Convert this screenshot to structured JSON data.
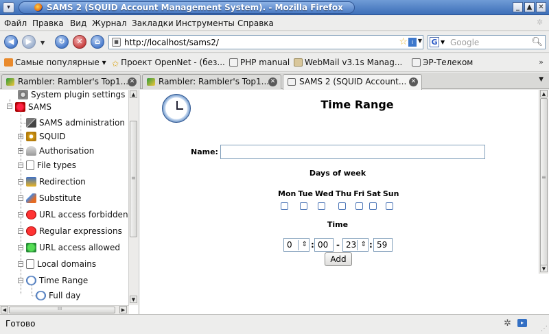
{
  "window": {
    "title": "SAMS 2 (SQUID Account Management System). - Mozilla Firefox",
    "controls": {
      "menu": "▾",
      "minimize": "_",
      "maximize": "▲",
      "close": "✕"
    }
  },
  "menubar": {
    "items": [
      "Файл",
      "Правка",
      "Вид",
      "Журнал",
      "Закладки",
      "Инструменты",
      "Справка"
    ]
  },
  "navbar": {
    "url": "http://localhost/sams2/",
    "search_placeholder": "Google",
    "search_engine": "G",
    "back": "◀",
    "forward": "▶",
    "reload": "↻",
    "stop": "✕",
    "home": "⌂"
  },
  "bookmarks": {
    "items": [
      "Самые популярные ▾",
      "Проект OpenNet - (без...",
      "PHP manual",
      "WebMail v3.1s Manag...",
      "ЭР-Телеком"
    ],
    "more": "»"
  },
  "tabs": {
    "items": [
      {
        "label": "Rambler: Rambler's Top1...",
        "active": false
      },
      {
        "label": "Rambler: Rambler's Top1...",
        "active": false
      },
      {
        "label": "SAMS 2 (SQUID Account...",
        "active": true
      }
    ]
  },
  "sidebar": {
    "items": [
      {
        "label": "System plugin settings",
        "expander": ""
      },
      {
        "label": "SAMS",
        "expander": "−"
      },
      {
        "label": "SAMS administration",
        "expander": ""
      },
      {
        "label": "SQUID",
        "expander": "+"
      },
      {
        "label": "Authorisation",
        "expander": "+"
      },
      {
        "label": "File types",
        "expander": "−"
      },
      {
        "label": "Redirection",
        "expander": "−"
      },
      {
        "label": "Substitute",
        "expander": "−"
      },
      {
        "label": "URL access forbidden",
        "expander": "−"
      },
      {
        "label": "Regular expressions",
        "expander": "−"
      },
      {
        "label": "URL access allowed",
        "expander": "−"
      },
      {
        "label": "Local domains",
        "expander": "−"
      },
      {
        "label": "Time Range",
        "expander": "−"
      },
      {
        "label": "Full day",
        "expander": ""
      }
    ],
    "scroll_mid": "≡",
    "hscroll_mid": "III"
  },
  "main": {
    "title": "Time Range",
    "name_label": "Name:",
    "name_value": "",
    "days_label": "Days of week",
    "days": [
      "Mon",
      "Tue",
      "Wed",
      "Thu",
      "Fri",
      "Sat",
      "Sun"
    ],
    "time_label": "Time",
    "start_hour": "0",
    "start_minute": "00",
    "end_hour": "23",
    "end_minute": "59",
    "colon": ":",
    "dash": "-",
    "add_button": "Add"
  },
  "status": {
    "text": "Готово"
  }
}
